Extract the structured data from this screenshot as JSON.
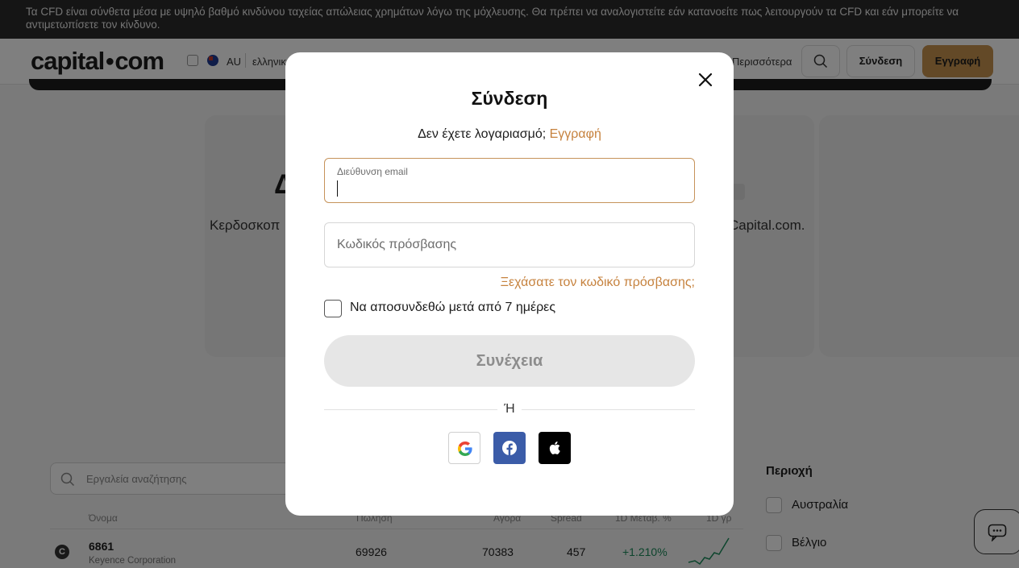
{
  "risk_banner": {
    "text": "Τα CFD είναι σύνθετα μέσα με υψηλό βαθμό κινδύνου ταχείας απώλειας χρημάτων λόγω της μόχλευσης. Θα πρέπει να αναλογιστείτε εάν κατανοείτε πως λειτουργούν τα CFD και εάν μπορείτε να αντιμετωπίσετε τον κίνδυνο."
  },
  "header": {
    "logo": {
      "left": "capital",
      "right": "com"
    },
    "region_code": "AU",
    "language": "ελληνικ",
    "more": "Περισσότερα",
    "login_label": "Σύνδεση",
    "signup_label": "Εγγραφή"
  },
  "hero": {
    "title_fragment": "Δ",
    "text_left": "Κερδοσκοπ",
    "text_right": "Capital.com."
  },
  "table": {
    "search_placeholder": "Εργαλεία αναζήτησης",
    "columns": [
      "Όνομα",
      "Πώληση",
      "Αγορά",
      "Spread",
      "1D Μεταβ. %",
      "1D γρ"
    ],
    "rows": [
      {
        "symbol": "6861",
        "name": "Keyence Corporation",
        "sell": "69926",
        "buy": "70383",
        "spread": "457",
        "change": "+1.210%"
      }
    ]
  },
  "filters": {
    "title": "Περιοχή",
    "items": [
      "Αυστραλία",
      "Βέλγιο"
    ]
  },
  "login_modal": {
    "title": "Σύνδεση",
    "no_account_text": "Δεν έχετε λογαριασμό;",
    "signup_link": "Εγγραφή",
    "email_label": "Διεύθυνση email",
    "email_value": "",
    "password_placeholder": "Κωδικός πρόσβασης",
    "forgot_link": "Ξεχάσατε τον κωδικό πρόσβασης;",
    "remember_label": "Να αποσυνδεθώ μετά από 7 ημέρες",
    "remember_checked": false,
    "continue_label": "Συνέχεια",
    "or_label": "Ή",
    "social": [
      "google-icon",
      "facebook-icon",
      "apple-icon"
    ]
  },
  "colors": {
    "accent": "#c6823e",
    "focus_border": "#c6935a",
    "facebook": "#3b5ca8",
    "apple": "#000000",
    "overlay": "rgba(0,0,0,0.5)"
  }
}
